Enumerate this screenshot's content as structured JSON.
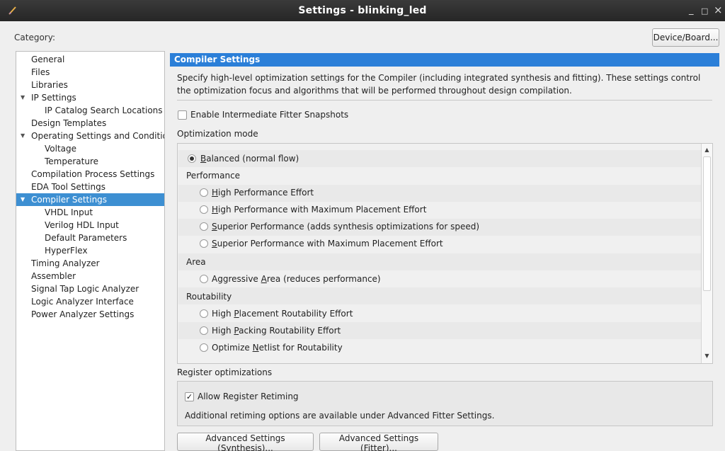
{
  "window": {
    "title": "Settings - blinking_led",
    "minimize_icon": "minimize-icon",
    "maximize_icon": "maximize-icon",
    "close_icon": "close-icon",
    "minimize": "_",
    "maximize": "□",
    "close": "×"
  },
  "category_label": "Category:",
  "device_board_button": "Device/Board...",
  "tree": {
    "items": [
      {
        "label": "General",
        "level": 0,
        "expandable": false
      },
      {
        "label": "Files",
        "level": 0,
        "expandable": false
      },
      {
        "label": "Libraries",
        "level": 0,
        "expandable": false
      },
      {
        "label": "IP Settings",
        "level": 0,
        "expandable": true
      },
      {
        "label": "IP Catalog Search Locations",
        "level": 1,
        "expandable": false
      },
      {
        "label": "Design Templates",
        "level": 0,
        "expandable": false
      },
      {
        "label": "Operating Settings and Conditions",
        "level": 0,
        "expandable": true
      },
      {
        "label": "Voltage",
        "level": 1,
        "expandable": false
      },
      {
        "label": "Temperature",
        "level": 1,
        "expandable": false
      },
      {
        "label": "Compilation Process Settings",
        "level": 0,
        "expandable": false
      },
      {
        "label": "EDA Tool Settings",
        "level": 0,
        "expandable": false
      },
      {
        "label": "Compiler Settings",
        "level": 0,
        "expandable": true,
        "selected": true
      },
      {
        "label": "VHDL Input",
        "level": 1,
        "expandable": false
      },
      {
        "label": "Verilog HDL Input",
        "level": 1,
        "expandable": false
      },
      {
        "label": "Default Parameters",
        "level": 1,
        "expandable": false
      },
      {
        "label": "HyperFlex",
        "level": 1,
        "expandable": false
      },
      {
        "label": "Timing Analyzer",
        "level": 0,
        "expandable": false
      },
      {
        "label": "Assembler",
        "level": 0,
        "expandable": false
      },
      {
        "label": "Signal Tap Logic Analyzer",
        "level": 0,
        "expandable": false
      },
      {
        "label": "Logic Analyzer Interface",
        "level": 0,
        "expandable": false
      },
      {
        "label": "Power Analyzer Settings",
        "level": 0,
        "expandable": false
      }
    ]
  },
  "panel": {
    "header": "Compiler Settings",
    "description": "Specify high-level optimization settings for the Compiler (including integrated synthesis and fitting).  These settings control the optimization focus and algorithms that will be performed throughout design compilation.",
    "enable_snapshots_label": "Enable Intermediate Fitter Snapshots",
    "enable_snapshots_checked": false,
    "optimization_mode_label": "Optimization mode",
    "balanced": {
      "pre": "",
      "u": "B",
      "post": "alanced (normal flow)",
      "selected": true
    },
    "performance_label": "Performance",
    "performance_options": [
      {
        "pre": "",
        "u": "H",
        "post": "igh Performance Effort"
      },
      {
        "pre": "",
        "u": "H",
        "post": "igh Performance with Maximum Placement Effort"
      },
      {
        "pre": "",
        "u": "S",
        "post": "uperior Performance (adds synthesis optimizations for speed)"
      },
      {
        "pre": "",
        "u": "S",
        "post": "uperior Performance with Maximum Placement Effort"
      }
    ],
    "area_label": "Area",
    "area_options": [
      {
        "pre": "Aggressive ",
        "u": "A",
        "post": "rea (reduces performance)"
      }
    ],
    "routability_label": "Routability",
    "routability_options": [
      {
        "pre": "High ",
        "u": "P",
        "post": "lacement Routability Effort"
      },
      {
        "pre": "High ",
        "u": "P",
        "post": "acking Routability Effort"
      },
      {
        "pre": "Optimize ",
        "u": "N",
        "post": "etlist for Routability"
      }
    ],
    "register_optimizations_label": "Register optimizations",
    "allow_retiming_label": "Allow Register Retiming",
    "allow_retiming_checked": true,
    "retiming_note": "Additional retiming options are available under Advanced Fitter Settings.",
    "advanced_synthesis": {
      "pre": "Advanced Settings (",
      "u": "S",
      "post": "ynthesis)..."
    },
    "advanced_fitter": {
      "pre": "Advanced Settings (",
      "u": "F",
      "post": "itter)..."
    },
    "check_mark": "✓",
    "scroll_up": "▲",
    "scroll_down": "▼",
    "tree_expand_arrow": "▼"
  },
  "colors": {
    "selection": "#3d8fd2",
    "header": "#2b7fd8",
    "titlebar": "#2e2e2e"
  }
}
